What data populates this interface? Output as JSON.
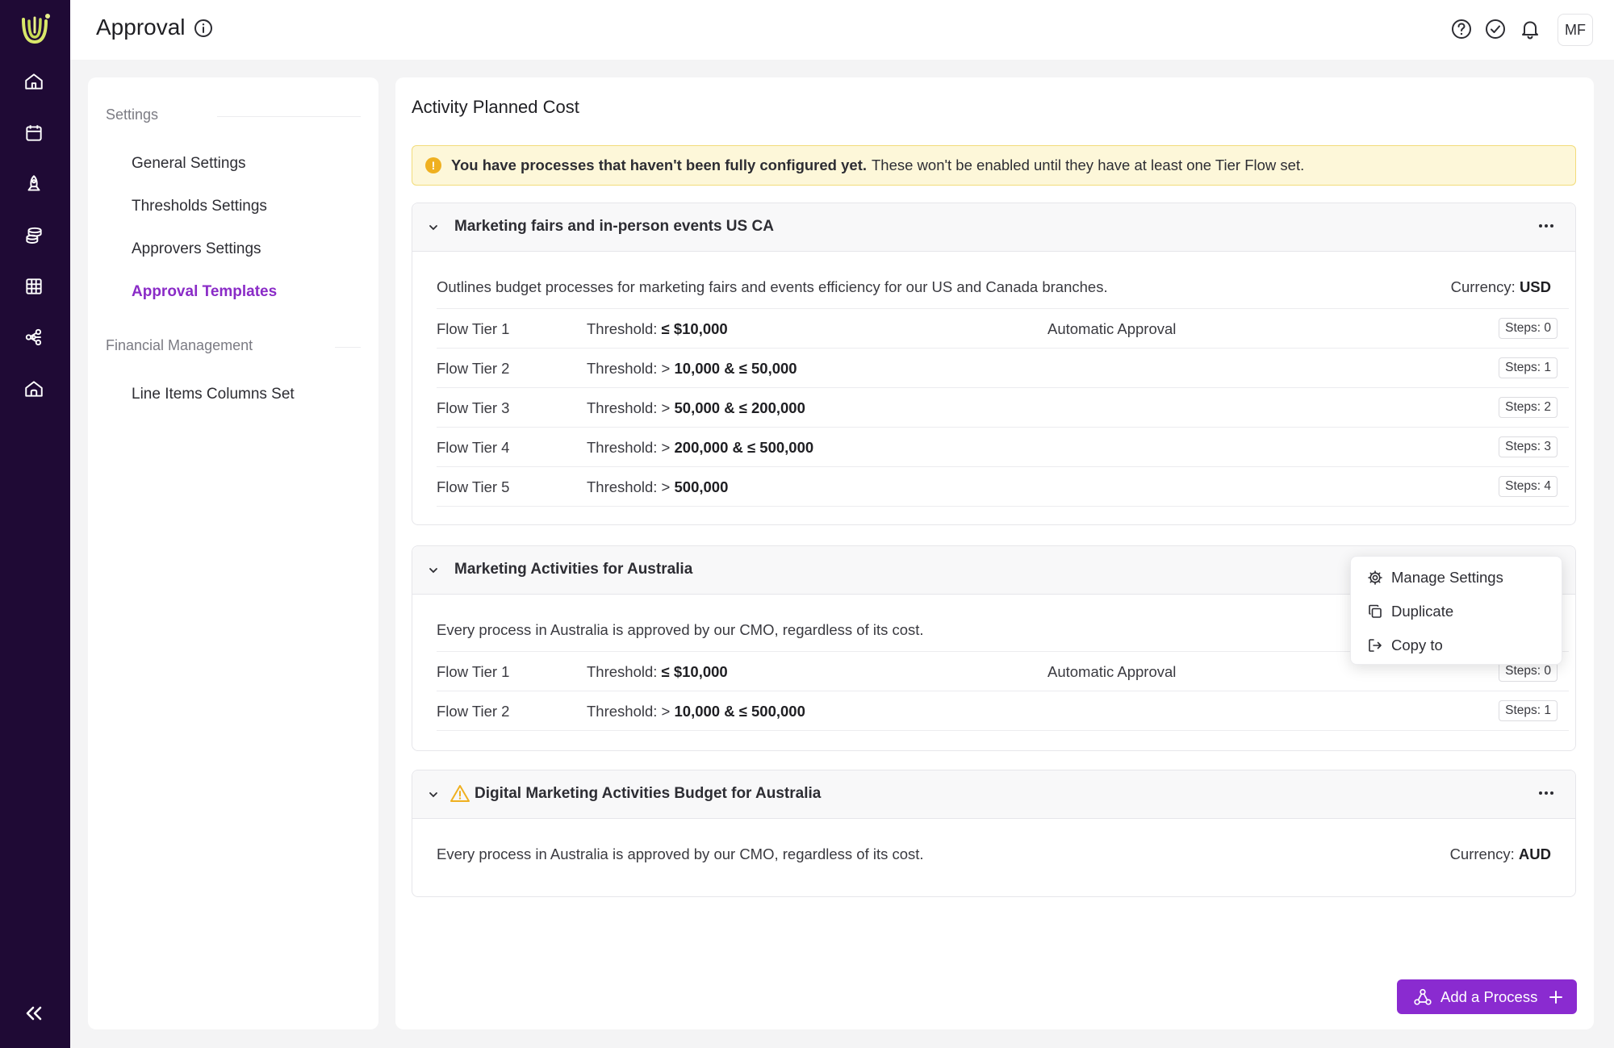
{
  "header": {
    "title": "Approval",
    "avatar_initials": "MF",
    "icons": [
      "help-icon",
      "check-circle-icon",
      "bell-icon"
    ]
  },
  "rail": {
    "icons": [
      "home-icon",
      "calendar-icon",
      "rocket-icon",
      "coins-icon",
      "grid-table-icon",
      "network-icon",
      "home-outline-icon"
    ],
    "collapse_icon": "double-chevron-left-icon"
  },
  "sidebar": {
    "groups": [
      {
        "label": "Settings",
        "items": [
          "General Settings",
          "Thresholds Settings",
          "Approvers Settings",
          "Approval Templates"
        ]
      },
      {
        "label": "Financial Management",
        "items": [
          "Line Items Columns Set"
        ]
      }
    ],
    "active_item": "Approval Templates"
  },
  "main": {
    "section_title": "Activity Planned Cost",
    "warning": {
      "bold": "You have processes that haven't been fully configured yet.",
      "text": "These won't be enabled until they have at least one Tier Flow set."
    },
    "cards": [
      {
        "name": "Marketing fairs and in-person events US CA",
        "description": "Outlines budget processes for marketing fairs and events efficiency for our US and Canada branches.",
        "currency_label": "Currency:",
        "currency": "USD",
        "tiers": [
          {
            "name": "Flow Tier 1",
            "threshold_label": "Threshold:",
            "threshold_value": "≤ $10,000",
            "approval": "Automatic Approval",
            "steps": "Steps: 0"
          },
          {
            "name": "Flow Tier 2",
            "threshold_label": "Threshold: >",
            "threshold_value": "10,000 & ≤ 50,000",
            "approval": "",
            "steps": "Steps: 1"
          },
          {
            "name": "Flow Tier 3",
            "threshold_label": "Threshold: >",
            "threshold_value": "50,000 & ≤ 200,000",
            "approval": "",
            "steps": "Steps: 2"
          },
          {
            "name": "Flow Tier 4",
            "threshold_label": "Threshold: >",
            "threshold_value": "200,000 & ≤ 500,000",
            "approval": "",
            "steps": "Steps: 3"
          },
          {
            "name": "Flow Tier 5",
            "threshold_label": "Threshold: >",
            "threshold_value": "500,000",
            "approval": "",
            "steps": "Steps: 4"
          }
        ]
      },
      {
        "name": "Marketing Activities for Australia",
        "description": "Every process in Australia is approved by our CMO, regardless of its cost.",
        "tiers": [
          {
            "name": "Flow Tier 1",
            "threshold_label": "Threshold:",
            "threshold_value": "≤ $10,000",
            "approval": "Automatic Approval",
            "steps": "Steps: 0"
          },
          {
            "name": "Flow Tier 2",
            "threshold_label": "Threshold: >",
            "threshold_value": "10,000 & ≤ 500,000",
            "approval": "",
            "steps": "Steps: 1"
          }
        ]
      },
      {
        "name": "Digital Marketing Activities Budget for Australia",
        "description": "Every process in Australia is approved by our CMO, regardless of its cost.",
        "currency_label": "Currency:",
        "currency": "AUD",
        "status_icon": "warning-triangle-icon"
      }
    ],
    "context_menu": {
      "items": [
        {
          "label": "Manage Settings",
          "icon": "gear-icon"
        },
        {
          "label": "Duplicate",
          "icon": "duplicate-icon"
        },
        {
          "label": "Copy to",
          "icon": "copy-to-icon"
        }
      ]
    },
    "add_button": {
      "label": "Add a Process",
      "icon": "workflow-icon"
    }
  },
  "colors": {
    "rail": "#1f0a35",
    "accent": "#8a2bc7",
    "button": "#8a2bd0",
    "warning_bg": "#fdf7d9",
    "warning_icon": "#efb020"
  }
}
